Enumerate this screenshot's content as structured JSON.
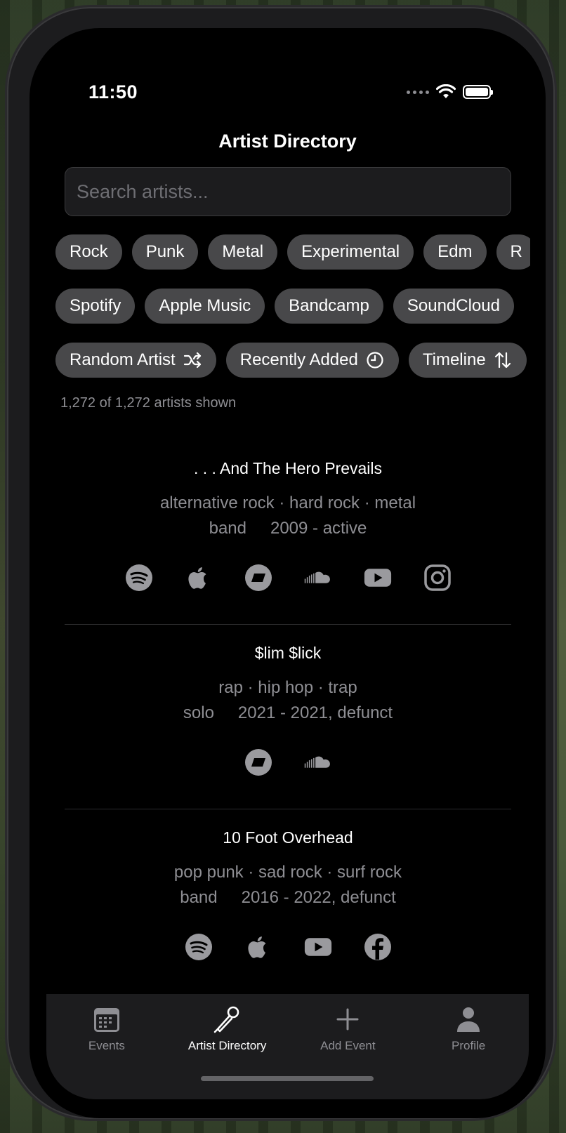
{
  "status": {
    "time": "11:50"
  },
  "header": {
    "title": "Artist Directory"
  },
  "search": {
    "placeholder": "Search artists..."
  },
  "genre_chips": [
    "Rock",
    "Punk",
    "Metal",
    "Experimental",
    "Edm",
    "R"
  ],
  "platform_chips": [
    "Spotify",
    "Apple Music",
    "Bandcamp",
    "SoundCloud"
  ],
  "action_chips": {
    "random": "Random Artist",
    "recent": "Recently Added",
    "timeline": "Timeline"
  },
  "count_text": "1,272 of 1,272 artists shown",
  "artists": [
    {
      "name": ". . . And The Hero Prevails",
      "genres": "alternative rock · hard rock · metal",
      "type": "band",
      "years": "2009 - active",
      "links": [
        "spotify-icon",
        "apple-music-icon",
        "bandcamp-icon",
        "soundcloud-icon",
        "youtube-icon",
        "instagram-icon"
      ]
    },
    {
      "name": "$lim $lick",
      "genres": "rap · hip hop · trap",
      "type": "solo",
      "years": "2021 - 2021, defunct",
      "links": [
        "bandcamp-icon",
        "soundcloud-icon"
      ]
    },
    {
      "name": "10 Foot Overhead",
      "genres": "pop punk · sad rock · surf rock",
      "type": "band",
      "years": "2016 - 2022, defunct",
      "links": [
        "spotify-icon",
        "apple-music-icon",
        "youtube-icon",
        "facebook-icon"
      ]
    }
  ],
  "tabs": [
    {
      "label": "Events",
      "icon": "calendar-icon"
    },
    {
      "label": "Artist Directory",
      "icon": "microphone-icon",
      "active": true
    },
    {
      "label": "Add Event",
      "icon": "plus-icon"
    },
    {
      "label": "Profile",
      "icon": "person-icon"
    }
  ],
  "colors": {
    "background": "#000000",
    "chip": "#48484a",
    "secondary_text": "#8e8e93",
    "icon_gray": "#9a9a9e"
  }
}
